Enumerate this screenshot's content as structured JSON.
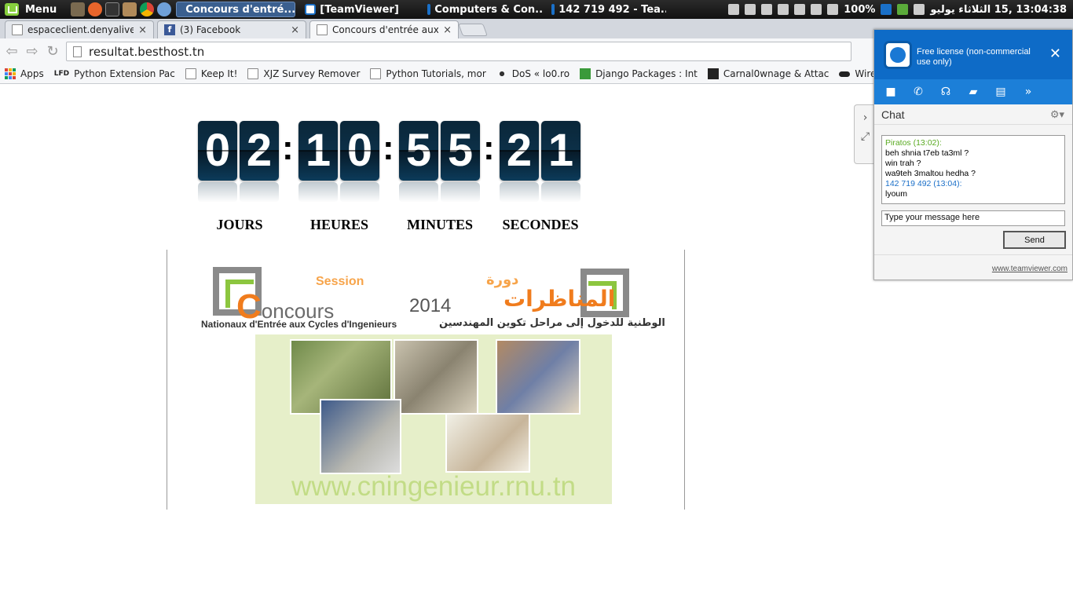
{
  "taskbar": {
    "menu_label": "Menu",
    "windows": [
      {
        "label": "Concours d'entré...",
        "active": true
      },
      {
        "label": "[TeamViewer]",
        "active": false
      },
      {
        "label": "Computers & Con...",
        "active": false
      },
      {
        "label": "142 719 492 - Tea...",
        "active": false
      }
    ],
    "battery": "100%",
    "clock": "13:04:38 ,15 الثلاثاء يوليو"
  },
  "browser": {
    "tabs": [
      {
        "title": "espaceclient.denyalive.co",
        "close": "×"
      },
      {
        "title": "(3) Facebook",
        "close": "×"
      },
      {
        "title": "Concours d'entrée aux cy",
        "close": "×"
      }
    ],
    "url": "resultat.besthost.tn",
    "bookmarks": [
      "Apps",
      "Python Extension Pac",
      "Keep It!",
      "XJZ Survey Remover",
      "Python Tutorials, mor",
      "DoS « lo0.ro",
      "Django Packages : Int",
      "Carnal0wnage & Attac",
      "WireMask - Bypass"
    ],
    "bookmark_lfd": "LFD"
  },
  "countdown": {
    "days": [
      "0",
      "2"
    ],
    "hours": [
      "1",
      "0"
    ],
    "minutes": [
      "5",
      "5"
    ],
    "seconds": [
      "2",
      "1"
    ],
    "separator": ":",
    "labels": {
      "days": "JOURS",
      "hours": "HEURES",
      "minutes": "MINUTES",
      "seconds": "SECONDES"
    }
  },
  "banner": {
    "session": "Session",
    "concours_first": "C",
    "concours_rest": "oncours",
    "year": "2014",
    "arabic_session": "دورة",
    "arabic_title": "المناظرات",
    "subtitle": "Nationaux d'Entrée aux Cycles d'Ingenieurs",
    "arabic_subtitle": "الوطنية للدخول إلى مراحل تكوين المهندسين",
    "url": "www.cningenieur.rnu.tn"
  },
  "teamviewer": {
    "license": "Free license (non-commercial use only)",
    "close": "✕",
    "chat_title": "Chat",
    "messages": [
      {
        "who": "Piratos (13:02):",
        "lines": [
          "beh shnia t7eb ta3ml ?",
          "win trah ?",
          "wa9teh 3maltou hedha ?"
        ]
      },
      {
        "who": "142 719 492 (13:04):",
        "lines": [
          "lyoum"
        ]
      }
    ],
    "input_placeholder": "Type your message here",
    "send": "Send",
    "footer_link": "www.teamviewer.com"
  },
  "colors": {
    "digit_bg": "#0c3048",
    "teamviewer_blue": "#0e6bc7",
    "banner_orange": "#f07c1d",
    "banner_green": "#8cc63f"
  }
}
